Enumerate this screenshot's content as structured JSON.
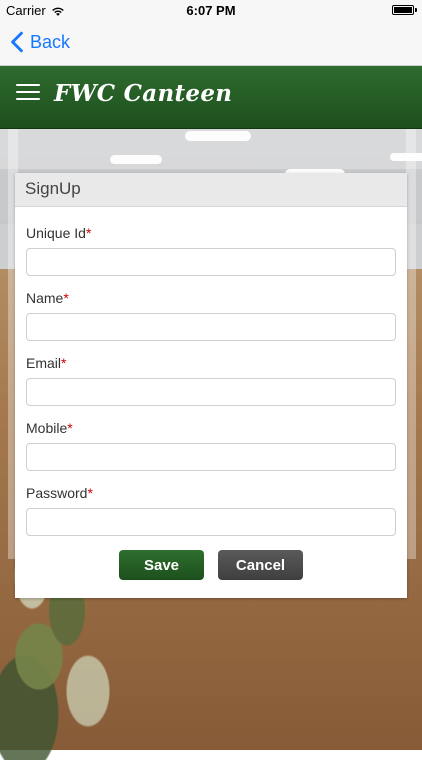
{
  "status_bar": {
    "carrier": "Carrier",
    "time": "6:07 PM"
  },
  "ios_nav": {
    "back_label": "Back",
    "back_icon": "chevron-left-icon"
  },
  "app_header": {
    "brand": "FWC Canteen",
    "menu_icon": "hamburger-menu-icon"
  },
  "signup": {
    "title": "SignUp",
    "fields": [
      {
        "label": "Unique Id",
        "required_mark": "*",
        "value": "",
        "placeholder": ""
      },
      {
        "label": "Name",
        "required_mark": "*",
        "value": "",
        "placeholder": ""
      },
      {
        "label": "Email",
        "required_mark": "*",
        "value": "",
        "placeholder": ""
      },
      {
        "label": "Mobile",
        "required_mark": "*",
        "value": "",
        "placeholder": ""
      },
      {
        "label": "Password",
        "required_mark": "*",
        "value": "",
        "placeholder": ""
      }
    ],
    "buttons": {
      "save_label": "Save",
      "cancel_label": "Cancel"
    }
  },
  "colors": {
    "ios_blue": "#1677ff",
    "header_green": "#1d4f1d",
    "required_red": "#d10000",
    "save_green": "#1d4f1d",
    "cancel_gray": "#3f3f3f"
  }
}
